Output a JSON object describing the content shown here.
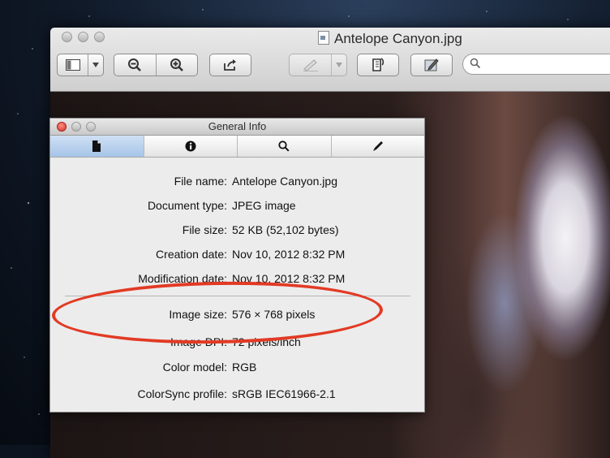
{
  "window": {
    "title": "Antelope Canyon.jpg",
    "title_icon": "jpeg-document-icon"
  },
  "toolbar": {
    "sidebar_icon": "sidebar-icon",
    "dropdown_icon": "chevron-down-icon",
    "zoom_out_icon": "zoom-out-icon",
    "zoom_in_icon": "zoom-in-icon",
    "share_icon": "share-icon",
    "annotate_icon": "pen-icon",
    "rotate_icon": "rotate-icon",
    "edit_icon": "edit-icon",
    "search_icon": "search-icon",
    "search_value": ""
  },
  "inspector": {
    "title": "General Info",
    "tabs": [
      {
        "name": "general-info",
        "icon": "document-icon"
      },
      {
        "name": "more-info",
        "icon": "info-icon"
      },
      {
        "name": "keywords",
        "icon": "search-icon"
      },
      {
        "name": "annotations",
        "icon": "pen-icon"
      }
    ],
    "rows": [
      {
        "label": "File name:",
        "value": "Antelope Canyon.jpg"
      },
      {
        "label": "Document type:",
        "value": "JPEG image"
      },
      {
        "label": "File size:",
        "value": "52 KB (52,102 bytes)"
      },
      {
        "label": "Creation date:",
        "value": "Nov 10, 2012 8:32 PM"
      },
      {
        "label": "Modification date:",
        "value": "Nov 10, 2012 8:32 PM"
      },
      {
        "label": "Image size:",
        "value": "576 × 768 pixels"
      },
      {
        "label": "Image DPI:",
        "value": "72 pixels/inch"
      },
      {
        "label": "Color model:",
        "value": "RGB"
      },
      {
        "label": "ColorSync profile:",
        "value": "sRGB IEC61966-2.1"
      }
    ]
  },
  "colors": {
    "annotation": "#e23a24",
    "active_tab": "#a6c4e8",
    "close_button": "#e0443c"
  }
}
